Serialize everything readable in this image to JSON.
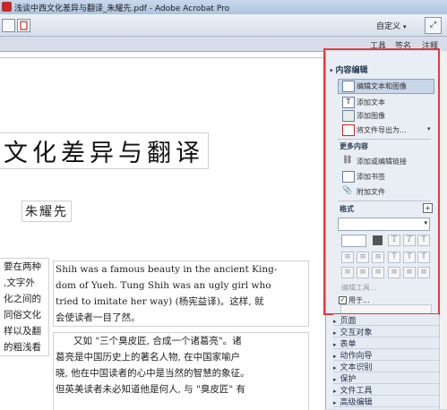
{
  "window": {
    "title": "浅谈中西文化差异与翻译_朱耀先.pdf - Adobe Acrobat Pro"
  },
  "toolbar": {
    "custom_label": "自定义"
  },
  "tabs": [
    "工具",
    "签名",
    "注释"
  ],
  "document": {
    "title": "文化差异与翻译",
    "author": "朱耀先",
    "left_column": [
      "要在两种",
      "文字外,",
      "化之间的",
      "同俗文化",
      "样以及翻",
      "的粗浅看"
    ],
    "para1": [
      "Shih was a famous beauty in the ancient King-",
      "dom of Yueh. Tung Shih was an ugly girl who",
      "tried to imitate her way) (杨宪益译)。这样, 就",
      "会使读者一目了然。"
    ],
    "para2": [
      "又如 \"三个臭皮匠, 合成一个诸葛亮\"。诸",
      "葛亮是中国历史上的著名人物, 在中国家喻户",
      "晓, 他在中国读者的心中是当然的智慧的象征。",
      "但英美读者未必知道他是何人, 与 \"臭皮匠\" 有"
    ]
  },
  "panel": {
    "content_edit_header": "内容编辑",
    "items": [
      "编辑文本和图像",
      "添加文本",
      "添加图像",
      "将文件导出为..."
    ],
    "more_content_header": "更多内容",
    "more_items": [
      "添加或编辑链接",
      "添加书签",
      "附加文件"
    ],
    "format_label": "格式",
    "edit_tool_label": "编辑工具...",
    "checkbox_label": "用于...",
    "checkbox_checked": true,
    "bottom_sections": [
      "页面",
      "交互对象",
      "表单",
      "动作向导",
      "文本识别",
      "保护",
      "文件工具",
      "高级编辑"
    ]
  },
  "colors": {
    "highlight": "#e23b3b",
    "panel_bg": "#e9eef5"
  }
}
